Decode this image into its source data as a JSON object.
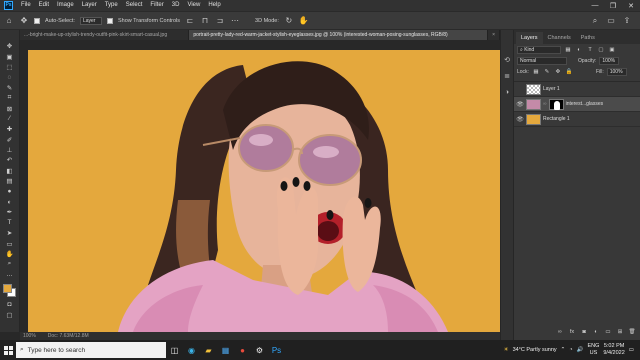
{
  "menu": {
    "logo": "Ps",
    "items": [
      "File",
      "Edit",
      "Image",
      "Layer",
      "Type",
      "Select",
      "Filter",
      "3D",
      "View",
      "Help"
    ]
  },
  "window_controls": [
    "—",
    "❐",
    "✕"
  ],
  "options_bar": {
    "auto_select_label": "Auto-Select:",
    "layer_select": "Layer",
    "show_transform_label": "Show Transform Controls",
    "mode_3d": "3D Mode:"
  },
  "tabs": [
    {
      "label": "...-bright-make-up-stylish-trendy-outfit-pink-skirt-smart-casual.jpg",
      "active": false
    },
    {
      "label": "portrait-pretty-lady-red-warm-jacket-stylish-eyeglasses.jpg @ 100% (interested-woman-posing-sunglasses, RGB/8)",
      "active": true
    },
    {
      "label": "×",
      "active": false
    }
  ],
  "status": {
    "zoom": "100%",
    "doc": "Doc: 7.63M/12.8M"
  },
  "layers_panel": {
    "tabs": [
      "Layers",
      "Channels",
      "Paths"
    ],
    "kind_label": "Kind",
    "blend_mode": "Normal",
    "opacity_label": "Opacity:",
    "opacity_value": "100%",
    "lock_label": "Lock:",
    "fill_label": "Fill:",
    "fill_value": "100%",
    "layers": [
      {
        "name": "Layer 1",
        "selected": false,
        "visible": false
      },
      {
        "name": "interest...glasses",
        "selected": true,
        "visible": true
      },
      {
        "name": "Rectangle 1",
        "selected": false,
        "visible": true
      }
    ]
  },
  "colors": {
    "canvas_bg": "#e4a83d",
    "foreground_swatch": "#e4a83d",
    "rect_thumb": "#e4a83d"
  },
  "taskbar": {
    "search_placeholder": "Type here to search",
    "weather": "34°C  Partly sunny",
    "lang_top": "ENG",
    "lang_bottom": "US",
    "time": "5:02 PM",
    "date": "9/4/2022"
  }
}
